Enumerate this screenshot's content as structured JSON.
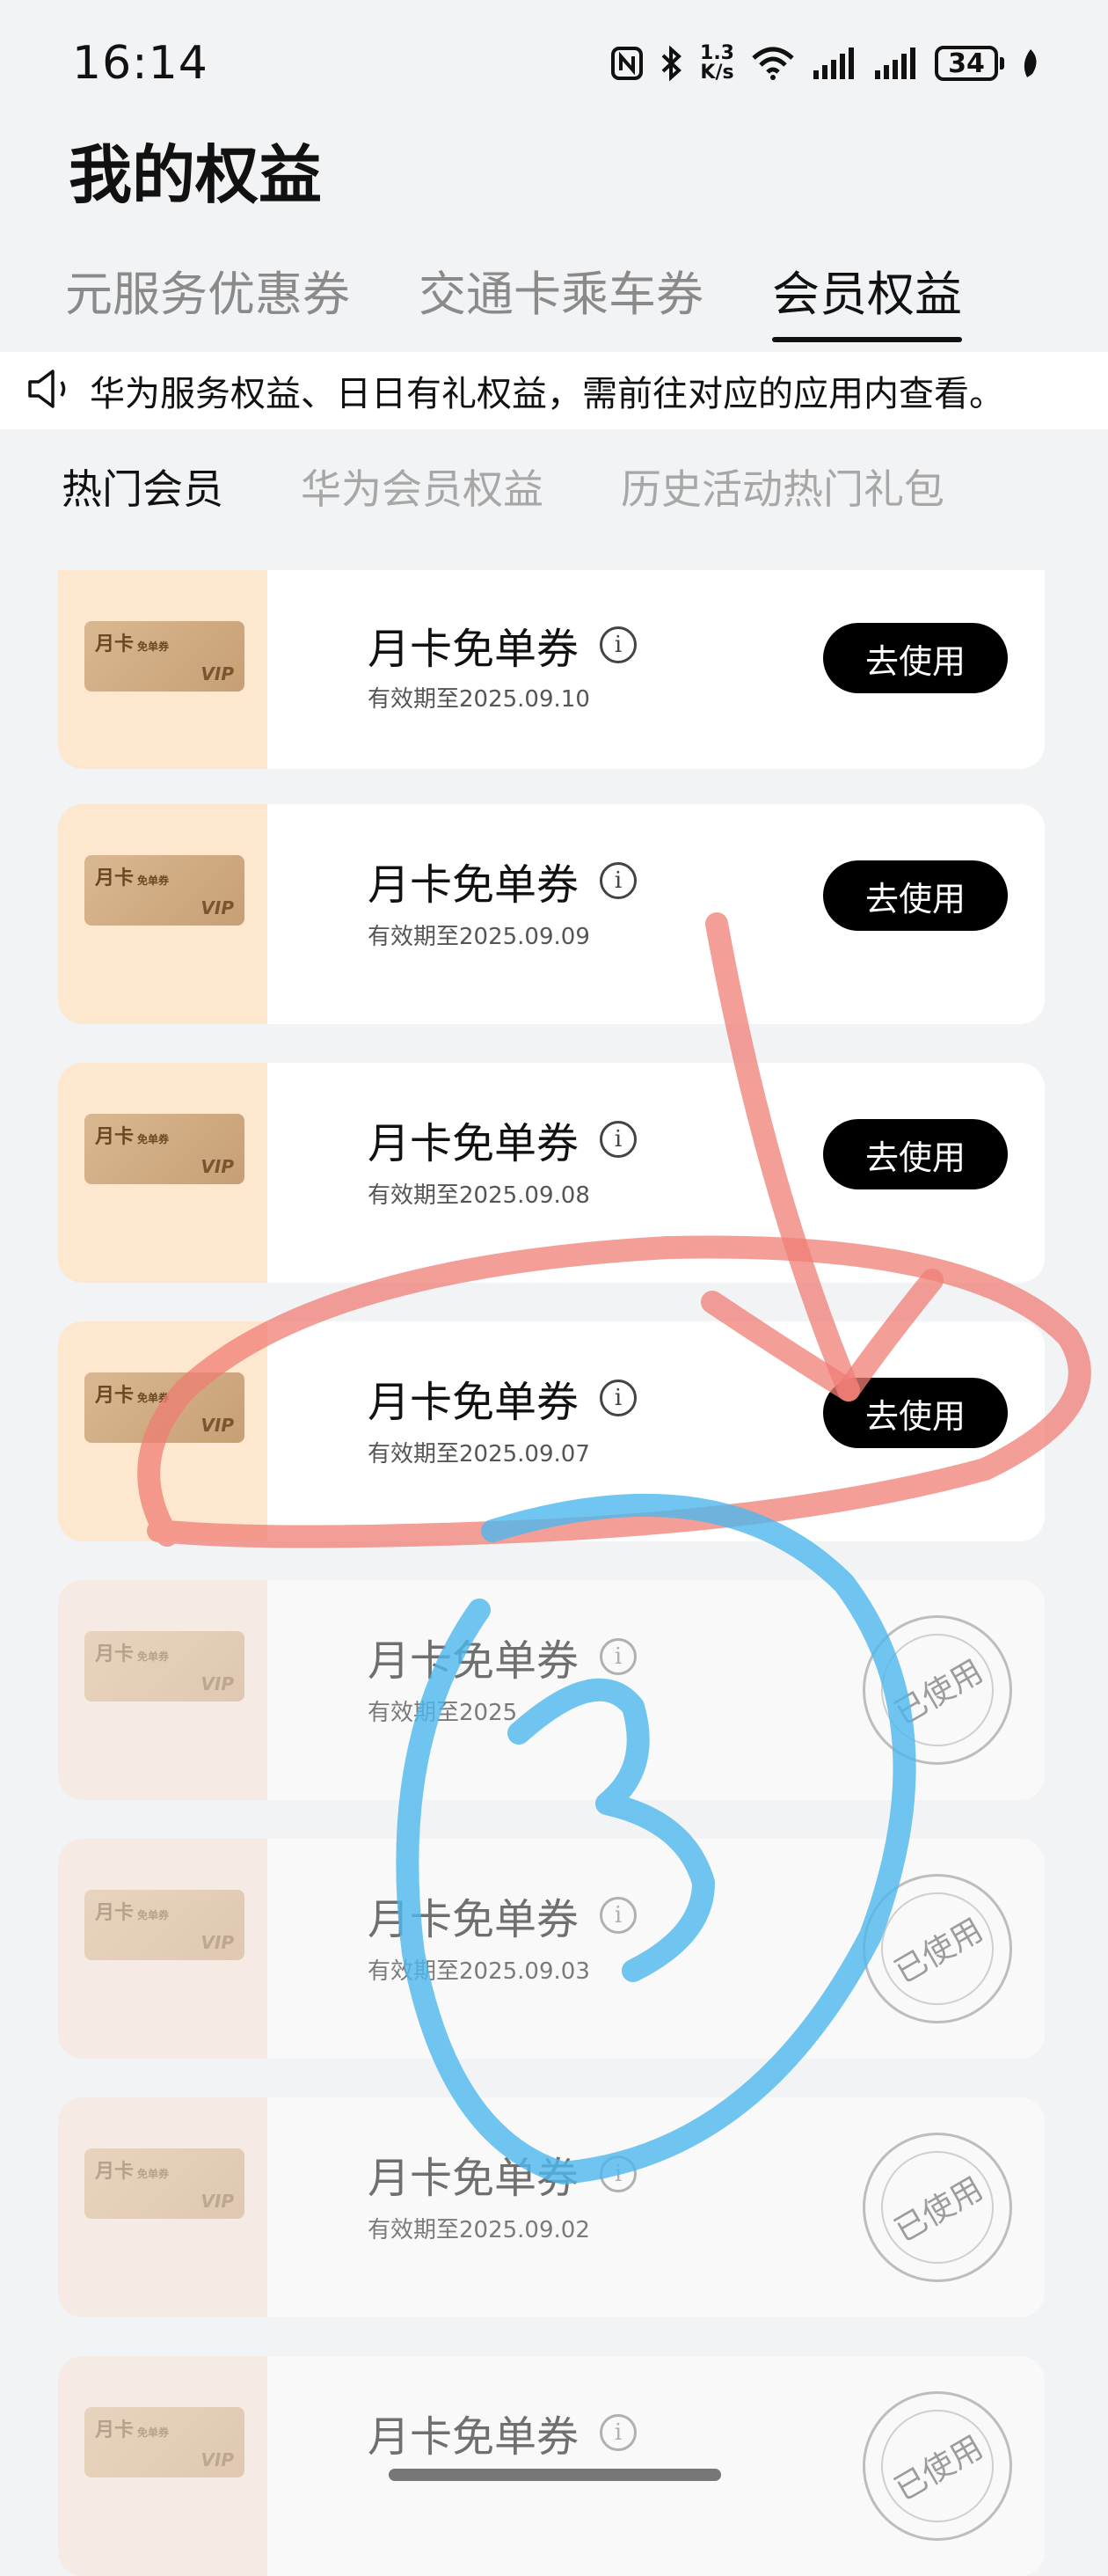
{
  "status_bar": {
    "time": "16:14",
    "net_speed_value": "1.3",
    "net_speed_unit": "K/s",
    "battery": "34",
    "icons": [
      "nfc-icon",
      "bluetooth-icon",
      "wifi-icon",
      "signal-icon",
      "signal-icon",
      "battery-icon",
      "leaf-icon"
    ]
  },
  "page": {
    "title": "我的权益"
  },
  "tabs": [
    {
      "label": "元服务优惠券",
      "active": false
    },
    {
      "label": "交通卡乘车券",
      "active": false
    },
    {
      "label": "会员权益",
      "active": true
    }
  ],
  "notice": {
    "icon": "speaker-icon",
    "text": "华为服务权益、日日有礼权益，需前往对应的应用内查看。"
  },
  "subtabs": [
    {
      "label": "热门会员",
      "active": true
    },
    {
      "label": "华为会员权益",
      "active": false
    },
    {
      "label": "历史活动热门礼包",
      "active": false
    }
  ],
  "coupon_card_art": {
    "label": "月卡",
    "small": "免单券",
    "badge": "VIP"
  },
  "coupons": [
    {
      "title": "月卡免单券",
      "date": "有效期至2025.09.10",
      "action": "去使用",
      "used": false
    },
    {
      "title": "月卡免单券",
      "date": "有效期至2025.09.09",
      "action": "去使用",
      "used": false
    },
    {
      "title": "月卡免单券",
      "date": "有效期至2025.09.08",
      "action": "去使用",
      "used": false
    },
    {
      "title": "月卡免单券",
      "date": "有效期至2025.09.07",
      "action": "去使用",
      "used": false
    },
    {
      "title": "月卡免单券",
      "date": "有效期至2025",
      "action": "已使用",
      "used": true
    },
    {
      "title": "月卡免单券",
      "date": "有效期至2025.09.03",
      "action": "已使用",
      "used": true
    },
    {
      "title": "月卡免单券",
      "date": "有效期至2025.09.02",
      "action": "已使用",
      "used": true
    },
    {
      "title": "月卡免单券",
      "date": "",
      "action": "已使用",
      "used": true
    }
  ],
  "colors": {
    "annotation_red": "#ef7d74",
    "annotation_blue": "#4db8ee",
    "card_accent": "#fde7ce"
  }
}
